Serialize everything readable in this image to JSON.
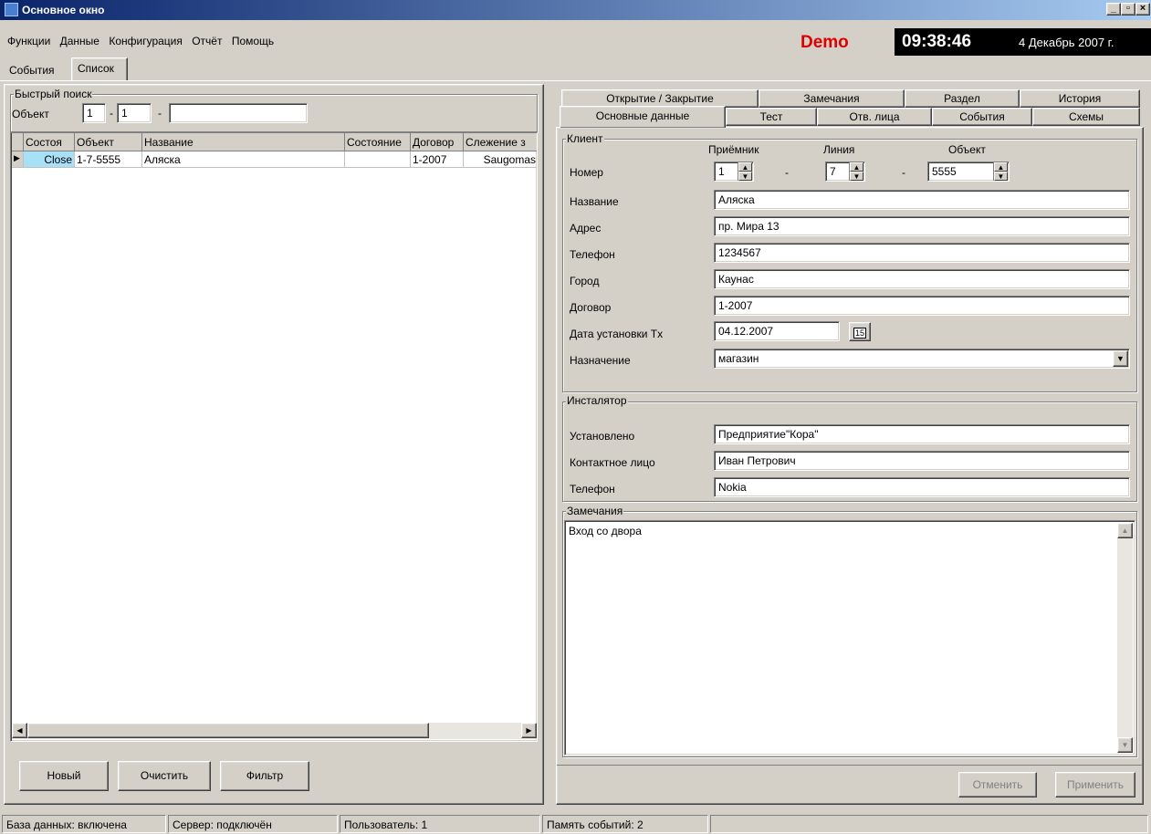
{
  "window": {
    "title": "Основное окно"
  },
  "menu": [
    "Функции",
    "Данные",
    "Конфигурация",
    "Отчёт",
    "Помощь"
  ],
  "header": {
    "demo": "Demo",
    "time": "09:38:46",
    "date": "4 Декабрь 2007 г."
  },
  "main_tabs": [
    "События",
    "Список"
  ],
  "quick_search": {
    "legend": "Быстрый поиск",
    "label": "Объект",
    "v1": "1",
    "v2": "1",
    "v3": ""
  },
  "grid": {
    "columns": [
      "Состоя",
      "Объект",
      "Название",
      "Состояние",
      "Договор",
      "Слежение з"
    ],
    "rows": [
      [
        "Close",
        "1-7-5555",
        "Аляска",
        "",
        "1-2007",
        "Saugomas"
      ]
    ]
  },
  "left_buttons": {
    "new": "Новый",
    "clear": "Очистить",
    "filter": "Фильтр"
  },
  "right_tabs_back": [
    "Открытие / Закрытие",
    "Замечания",
    "Раздел",
    "История"
  ],
  "right_tabs_front": [
    "Основные данные",
    "Тест",
    "Отв. лица",
    "События",
    "Схемы"
  ],
  "client": {
    "legend": "Клиент",
    "hdr_receiver": "Приёмник",
    "hdr_line": "Линия",
    "hdr_object": "Объект",
    "number_label": "Номер",
    "receiver": "1",
    "line": "7",
    "object": "5555",
    "dash": "-",
    "name_label": "Название",
    "name": "Аляска",
    "address_label": "Адрес",
    "address": "пр. Мира 13",
    "phone_label": "Телефон",
    "phone": "1234567",
    "city_label": "Город",
    "city": "Каунас",
    "contract_label": "Договор",
    "contract": "1-2007",
    "install_date_label": "Дата установки Tx",
    "install_date": "04.12.2007",
    "cal_icon": "15",
    "purpose_label": "Назначение",
    "purpose": "магазин"
  },
  "installer": {
    "legend": "Инсталятор",
    "installed_label": "Установлено",
    "installed": "Предприятие\"Кора\"",
    "contact_label": "Контактное лицо",
    "contact": "Иван Петрович",
    "phone_label": "Телефон",
    "phone": "Nokia"
  },
  "notes": {
    "legend": "Замечания",
    "text": "Вход со двора"
  },
  "actions": {
    "cancel": "Отменить",
    "apply": "Применить"
  },
  "status": {
    "db": "База данных: включена",
    "server": "Сервер: подключён",
    "user": "Пользователь: 1",
    "events": "Память событий: 2"
  }
}
